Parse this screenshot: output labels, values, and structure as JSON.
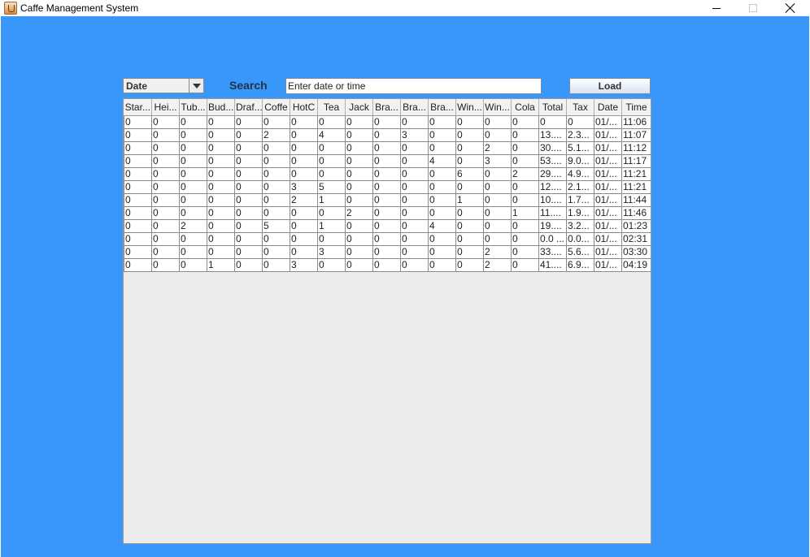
{
  "window": {
    "title": "Caffe Management System"
  },
  "toolbar": {
    "combo_value": "Date",
    "search_label": "Search",
    "search_placeholder": "Enter date or time",
    "load_label": "Load"
  },
  "table": {
    "columns": [
      "Star...",
      "Hei...",
      "Tub...",
      "Bud...",
      "Draf...",
      "Coffe",
      "HotC",
      "Tea",
      "Jack",
      "Bra...",
      "Bra...",
      "Bra...",
      "Win...",
      "Win...",
      "Cola",
      "Total",
      "Tax",
      "Date",
      "Time"
    ],
    "rows": [
      [
        "0",
        "0",
        "0",
        "0",
        "0",
        "0",
        "0",
        "0",
        "0",
        "0",
        "0",
        "0",
        "0",
        "0",
        "0",
        "0",
        "0",
        "01/...",
        "11:06"
      ],
      [
        "0",
        "0",
        "0",
        "0",
        "0",
        "2",
        "0",
        "4",
        "0",
        "0",
        "3",
        "0",
        "0",
        "0",
        "0",
        "13....",
        "2.3...",
        "01/...",
        "11:07"
      ],
      [
        "0",
        "0",
        "0",
        "0",
        "0",
        "0",
        "0",
        "0",
        "0",
        "0",
        "0",
        "0",
        "0",
        "2",
        "0",
        "30....",
        "5.1...",
        "01/...",
        "11:12"
      ],
      [
        "0",
        "0",
        "0",
        "0",
        "0",
        "0",
        "0",
        "0",
        "0",
        "0",
        "0",
        "4",
        "0",
        "3",
        "0",
        "53....",
        "9.0...",
        "01/...",
        "11:17"
      ],
      [
        "0",
        "0",
        "0",
        "0",
        "0",
        "0",
        "0",
        "0",
        "0",
        "0",
        "0",
        "0",
        "6",
        "0",
        "2",
        "29....",
        "4.9...",
        "01/...",
        "11:21"
      ],
      [
        "0",
        "0",
        "0",
        "0",
        "0",
        "0",
        "3",
        "5",
        "0",
        "0",
        "0",
        "0",
        "0",
        "0",
        "0",
        "12....",
        "2.1...",
        "01/...",
        "11:21"
      ],
      [
        "0",
        "0",
        "0",
        "0",
        "0",
        "0",
        "2",
        "1",
        "0",
        "0",
        "0",
        "0",
        "1",
        "0",
        "0",
        "10....",
        "1.7...",
        "01/...",
        "11:44"
      ],
      [
        "0",
        "0",
        "0",
        "0",
        "0",
        "0",
        "0",
        "0",
        "2",
        "0",
        "0",
        "0",
        "0",
        "0",
        "1",
        "11....",
        "1.9...",
        "01/...",
        "11:46"
      ],
      [
        "0",
        "0",
        "2",
        "0",
        "0",
        "5",
        "0",
        "1",
        "0",
        "0",
        "0",
        "4",
        "0",
        "0",
        "0",
        "19....",
        "3.2...",
        "01/...",
        "01:23"
      ],
      [
        "0",
        "0",
        "0",
        "0",
        "0",
        "0",
        "0",
        "0",
        "0",
        "0",
        "0",
        "0",
        "0",
        "0",
        "0",
        "0.0 ...",
        "0.0...",
        "01/...",
        "02:31"
      ],
      [
        "0",
        "0",
        "0",
        "0",
        "0",
        "0",
        "0",
        "3",
        "0",
        "0",
        "0",
        "0",
        "0",
        "2",
        "0",
        "33....",
        "5.6...",
        "01/...",
        "03:30"
      ],
      [
        "0",
        "0",
        "0",
        "1",
        "0",
        "0",
        "3",
        "0",
        "0",
        "0",
        "0",
        "0",
        "0",
        "2",
        "0",
        "41....",
        "6.9...",
        "01/...",
        "04:19"
      ]
    ]
  }
}
